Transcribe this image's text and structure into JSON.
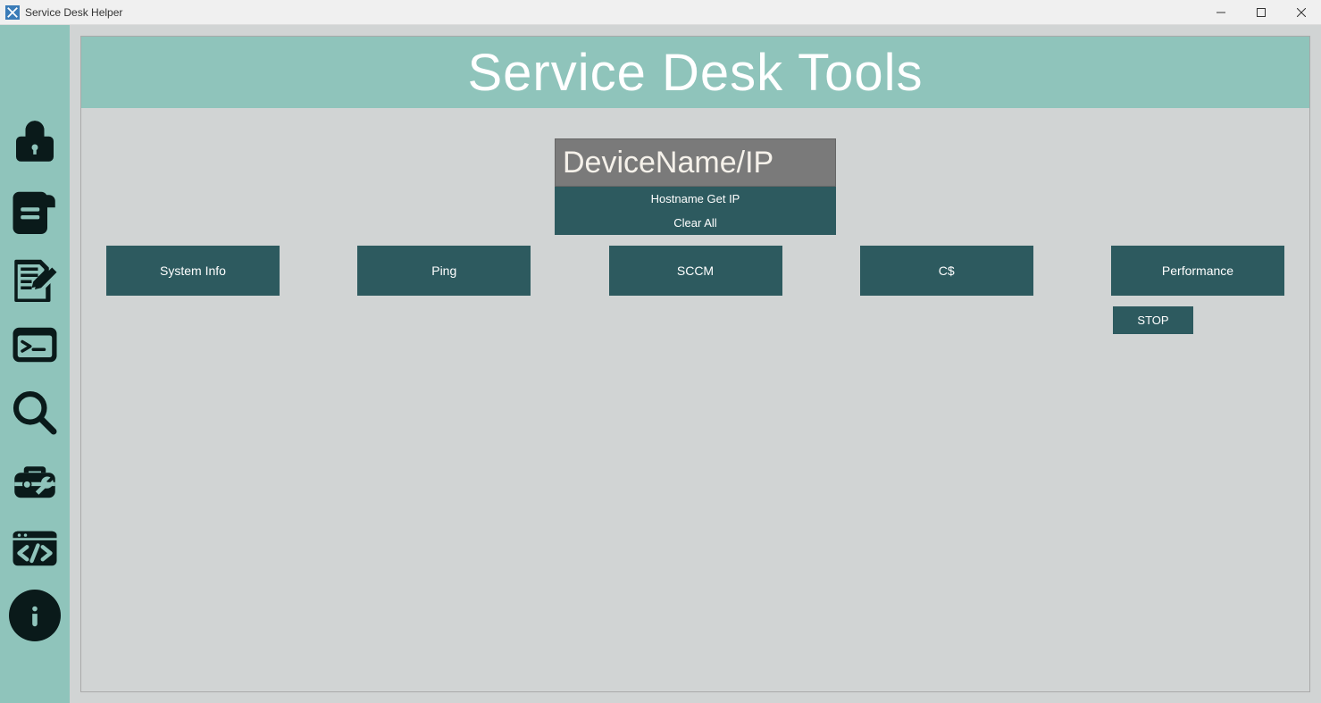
{
  "window": {
    "title": "Service Desk Helper"
  },
  "header": {
    "title": "Service Desk Tools"
  },
  "device": {
    "placeholder": "DeviceName/IP",
    "hostname_btn": "Hostname Get IP",
    "clear_btn": "Clear All"
  },
  "buttons": {
    "system_info": "System Info",
    "ping": "Ping",
    "sccm": "SCCM",
    "cdollar": "C$",
    "performance": "Performance",
    "stop": "STOP"
  },
  "sidebar": {
    "items": [
      {
        "name": "lock",
        "label": "Lock"
      },
      {
        "name": "notepad",
        "label": "Notepad"
      },
      {
        "name": "edit",
        "label": "Edit"
      },
      {
        "name": "terminal",
        "label": "Terminal"
      },
      {
        "name": "search",
        "label": "Search"
      },
      {
        "name": "toolbox",
        "label": "Toolbox"
      },
      {
        "name": "code",
        "label": "Code"
      },
      {
        "name": "info",
        "label": "Info"
      }
    ]
  }
}
